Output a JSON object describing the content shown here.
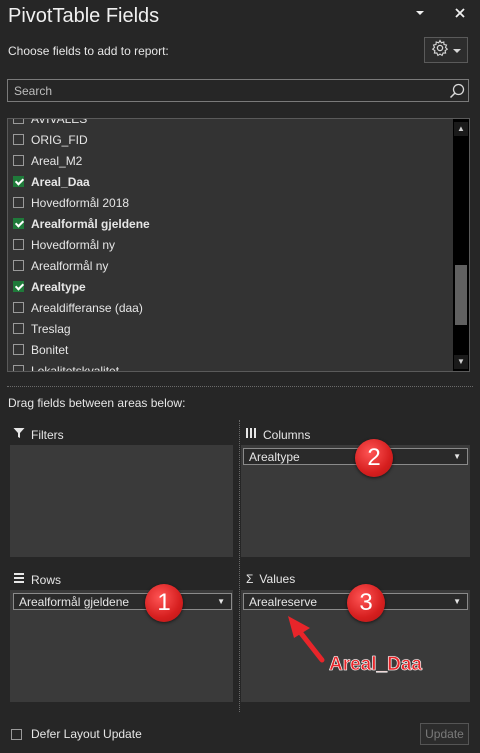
{
  "panel": {
    "title": "PivotTable Fields",
    "choose_label": "Choose fields to add to report:"
  },
  "search": {
    "placeholder": "Search"
  },
  "fields": [
    {
      "label": "AVIVALES",
      "checked": false,
      "bold": false
    },
    {
      "label": "ORIG_FID",
      "checked": false,
      "bold": false
    },
    {
      "label": "Areal_M2",
      "checked": false,
      "bold": false
    },
    {
      "label": "Areal_Daa",
      "checked": true,
      "bold": true
    },
    {
      "label": "Hovedformål 2018",
      "checked": false,
      "bold": false
    },
    {
      "label": "Arealformål gjeldene",
      "checked": true,
      "bold": true
    },
    {
      "label": "Hovedformål ny",
      "checked": false,
      "bold": false
    },
    {
      "label": "Arealformål ny",
      "checked": false,
      "bold": false
    },
    {
      "label": "Arealtype",
      "checked": true,
      "bold": true
    },
    {
      "label": "Arealdifferanse (daa)",
      "checked": false,
      "bold": false
    },
    {
      "label": "Treslag",
      "checked": false,
      "bold": false
    },
    {
      "label": "Bonitet",
      "checked": false,
      "bold": false
    },
    {
      "label": "Lokalitetskvalitet",
      "checked": false,
      "bold": false
    }
  ],
  "areas": {
    "drag_label": "Drag fields between areas below:",
    "filters": {
      "title": "Filters",
      "items": []
    },
    "columns": {
      "title": "Columns",
      "items": [
        "Arealtype"
      ]
    },
    "rows": {
      "title": "Rows",
      "items": [
        "Arealformål gjeldene"
      ]
    },
    "values": {
      "title": "Values",
      "items": [
        "Arealreserve"
      ]
    }
  },
  "annotations": {
    "badge1": "1",
    "badge2": "2",
    "badge3": "3",
    "arrow_label": "Areal_Daa",
    "color": "#e8252a"
  },
  "footer": {
    "defer_label": "Defer Layout Update",
    "update_label": "Update"
  },
  "colors": {
    "background": "#262626",
    "checkbox_checked": "#1f7a3a"
  },
  "icons": {
    "dropdown": "chevron-down-icon",
    "close": "close-icon",
    "settings": "gear-icon",
    "search": "search-icon"
  }
}
